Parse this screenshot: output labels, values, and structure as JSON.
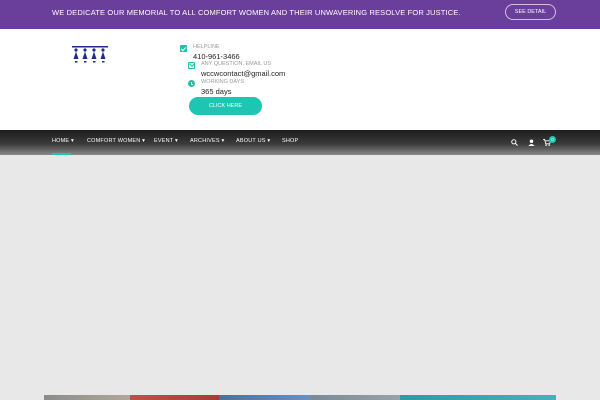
{
  "topbar": {
    "message": "WE DEDICATE OUR MEMORIAL TO ALL COMFORT WOMEN AND THEIR UNWAVERING RESOLVE FOR JUSTICE.",
    "button_label": "SEE DETAIL",
    "bg_color": "#6a3e9b"
  },
  "header": {
    "logo_icon": "four-women-figures-logo",
    "contacts": [
      {
        "icon": "check-icon",
        "label": "HELPLINE",
        "value": "410-961-3466"
      },
      {
        "icon": "mail-icon",
        "label": "ANY QUESTION, EMAIL US",
        "value": "wccwcontact@gmail.com"
      },
      {
        "icon": "clock-icon",
        "label": "WORKING DAYS",
        "value": "365 days"
      }
    ],
    "cta_label": "CLICK HERE",
    "accent_color": "#1fc5b3"
  },
  "nav": {
    "items": [
      {
        "label": "HOME ▾",
        "active": true
      },
      {
        "label": "COMFORT WOMEN ▾",
        "active": false
      },
      {
        "label": "EVENT ▾",
        "active": false
      },
      {
        "label": "ARCHIVES ▾",
        "active": false
      },
      {
        "label": "ABOUT US ▾",
        "active": false
      },
      {
        "label": "SHOP",
        "active": false
      }
    ],
    "icons": [
      "search-icon",
      "user-icon",
      "cart-icon"
    ],
    "cart_count": "0"
  }
}
